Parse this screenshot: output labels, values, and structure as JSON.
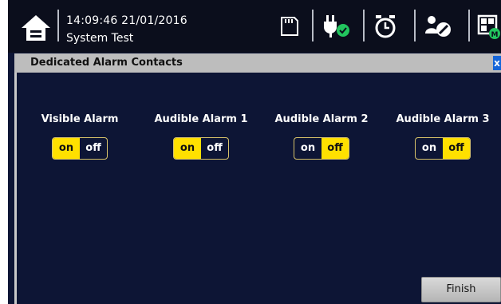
{
  "header": {
    "datetime": "14:09:46 21/01/2016",
    "status": "System Test"
  },
  "panel": {
    "title": "Dedicated Alarm Contacts",
    "close_glyph": "x"
  },
  "alarms": [
    {
      "label": "Visible Alarm",
      "on_label": "on",
      "off_label": "off",
      "state": "on"
    },
    {
      "label": "Audible Alarm 1",
      "on_label": "on",
      "off_label": "off",
      "state": "on"
    },
    {
      "label": "Audible Alarm 2",
      "on_label": "on",
      "off_label": "off",
      "state": "off"
    },
    {
      "label": "Audible Alarm 3",
      "on_label": "on",
      "off_label": "off",
      "state": "off"
    }
  ],
  "footer": {
    "finish_label": "Finish"
  },
  "icons": [
    "home-icon",
    "sd-card-icon",
    "power-plug-ok-icon",
    "alarm-clock-icon",
    "wrench-user-icon",
    "window-layout-icon"
  ],
  "colors": {
    "background": "#0d1535",
    "toggle_active": "#ffe000",
    "ok_badge": "#22c55e"
  }
}
